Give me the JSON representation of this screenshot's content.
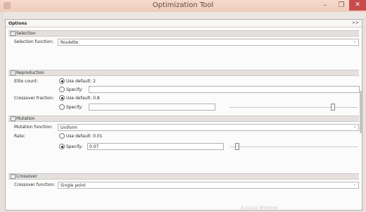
{
  "window": {
    "title": "Optimization Tool",
    "minimize": "–",
    "maximize": "❐",
    "close": "✕"
  },
  "panel": {
    "title": "Options",
    "expand_label": ">>"
  },
  "selection": {
    "header": "Selection",
    "function_label": "Selection function:",
    "function_value": "Roulette"
  },
  "reproduction": {
    "header": "Reproduction",
    "elite_label": "Elite count:",
    "elite_default": "Use default: 2",
    "elite_specify": "Specify:",
    "crossover_label": "Crossover fraction:",
    "crossover_default": "Use default: 0.8",
    "crossover_specify": "Specify:"
  },
  "mutation": {
    "header": "Mutation",
    "function_label": "Mutation function:",
    "function_value": "Uniform",
    "rate_label": "Rate:",
    "rate_default": "Use default: 0.01",
    "rate_specify": "Specify:",
    "rate_value": "0.07"
  },
  "crossover": {
    "header": "Crossover",
    "function_label": "Crossover function:",
    "function_value": "Single point"
  },
  "icons": {
    "collapse": "minus-box-icon",
    "dropdown": "chevron-down-icon"
  },
  "watermark": "Activate Windows"
}
